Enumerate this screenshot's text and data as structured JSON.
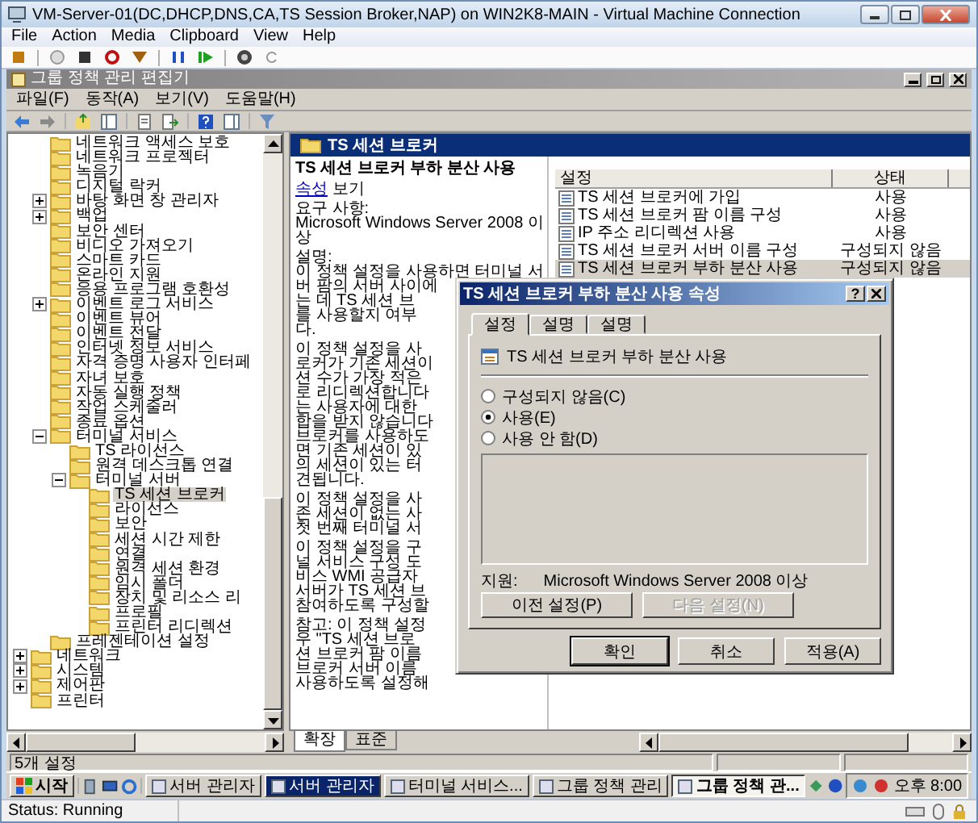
{
  "vm_window": {
    "title": "VM-Server-01(DC,DHCP,DNS,CA,TS Session Broker,NAP) on WIN2K8-MAIN - Virtual Machine Connection",
    "menu": [
      "File",
      "Action",
      "Media",
      "Clipboard",
      "View",
      "Help"
    ],
    "status": "Status: Running"
  },
  "mmc": {
    "title": "그룹 정책 관리 편집기",
    "menu": [
      "파일(F)",
      "동작(A)",
      "보기(V)",
      "도움말(H)"
    ]
  },
  "tree": {
    "items": [
      {
        "children": [
          {
            "label": "네트워크 액세스 보호",
            "selected": false
          },
          {
            "label": "네트워크 프로젝터",
            "selected": false
          },
          {
            "label": "녹음기",
            "selected": false
          },
          {
            "label": "디지털 락커",
            "selected": false
          },
          {
            "label": "바탕 화면 창 관리자",
            "selected": false,
            "expanded": false
          },
          {
            "label": "백업",
            "selected": false,
            "expanded": false
          },
          {
            "label": "보안 센터",
            "selected": false
          },
          {
            "label": "비디오 가져오기",
            "selected": false
          },
          {
            "label": "스마트 카드",
            "selected": false
          },
          {
            "label": "온라인 지원",
            "selected": false
          },
          {
            "label": "응용 프로그램 호환성",
            "selected": false
          },
          {
            "label": "이벤트 로그 서비스",
            "selected": false,
            "expanded": false
          },
          {
            "label": "이벤트 뷰어",
            "selected": false
          },
          {
            "label": "이벤트 전달",
            "selected": false
          },
          {
            "label": "인터넷 정보 서비스",
            "selected": false
          },
          {
            "label": "자격 증명 사용자 인터페",
            "selected": false
          },
          {
            "label": "자녀 보호",
            "selected": false
          },
          {
            "label": "자동 실행 정책",
            "selected": false
          },
          {
            "label": "작업 스케줄러",
            "selected": false
          },
          {
            "label": "종료 옵션",
            "selected": false
          },
          {
            "label": "터미널 서비스",
            "selected": false,
            "expanded": true,
            "children": [
              {
                "label": "TS 라이선스",
                "selected": false
              },
              {
                "label": "원격 데스크톱 연결",
                "selected": false
              },
              {
                "label": "터미널 서버",
                "selected": false,
                "expanded": true,
                "children": [
                  {
                    "label": "TS 세션 브로커",
                    "selected": true
                  },
                  {
                    "label": "라이선스",
                    "selected": false
                  },
                  {
                    "label": "보안",
                    "selected": false
                  },
                  {
                    "label": "세션 시간 제한",
                    "selected": false
                  },
                  {
                    "label": "연결",
                    "selected": false
                  },
                  {
                    "label": "원격 세션 환경",
                    "selected": false
                  },
                  {
                    "label": "임시 폴더",
                    "selected": false
                  },
                  {
                    "label": "장치 및 리소스 리",
                    "selected": false
                  },
                  {
                    "label": "프로필",
                    "selected": false
                  },
                  {
                    "label": "프린터 리디렉션",
                    "selected": false
                  }
                ]
              }
            ]
          },
          {
            "label": "프레젠테이션 설정",
            "selected": false
          }
        ]
      },
      {
        "label": "네트워크",
        "selected": false,
        "expanded": false
      },
      {
        "label": "시스템",
        "selected": false,
        "expanded": false
      },
      {
        "label": "제어판",
        "selected": false,
        "expanded": false
      },
      {
        "label": "프린터",
        "selected": false
      }
    ]
  },
  "pane_header": "TS 세션 브로커",
  "details": {
    "heading": "TS 세션 브로커 부하 분산 사용",
    "link": "속성",
    "link_rest": "보기",
    "paragraphs": [
      [
        "요구 사항:",
        "Microsoft Windows Server 2008 이",
        "상"
      ],
      [
        "설명:",
        "이 정책 설정을 사용하면 터미널 서",
        "버 팜의 서버 사이에",
        "는 데 TS 세션 브",
        "를 사용할지 여부",
        "다."
      ],
      [
        "이 정책 설정을 사",
        "로커가 기존 세션이",
        "션 수가 가장 적은",
        "로 리디렉션합니다",
        "는 사용자에 대한",
        "합을 받지 않습니다",
        "브로커를 사용하도",
        "면 기존 세션이 있",
        "의 세션이 있는 터",
        "견됩니다."
      ],
      [
        "이 정책 설정을 사",
        "존 세션이 없는 사",
        "첫 번째 터미널 서"
      ],
      [
        "이 정책 설정을 구",
        "널 서비스 구성 도",
        "비스 WMI 공급자",
        "서버가 TS 세션 브",
        "참여하도록 구성할"
      ],
      [
        "참고: 이 정책 설정",
        "우 \"TS 세션 브로",
        "션 브로커 팜 이름",
        "브로커 서버 이름",
        "사용하도록 설정해"
      ]
    ]
  },
  "list": {
    "columns": [
      "설정",
      "상태"
    ],
    "rows": [
      {
        "name": "TS 세션 브로커에 가입",
        "state": "사용",
        "selected": false
      },
      {
        "name": "TS 세션 브로커 팜 이름 구성",
        "state": "사용",
        "selected": false
      },
      {
        "name": "IP 주소 리디렉션 사용",
        "state": "사용",
        "selected": false
      },
      {
        "name": "TS 세션 브로커 서버 이름 구성",
        "state": "구성되지 않음",
        "selected": false
      },
      {
        "name": "TS 세션 브로커 부하 분산 사용",
        "state": "구성되지 않음",
        "selected": true
      }
    ]
  },
  "dialog": {
    "title": "TS 세션 브로커 부하 분산 사용 속성",
    "help": "?",
    "tabs": [
      {
        "label": "설정",
        "selected": true
      },
      {
        "label": "설명",
        "selected": false
      },
      {
        "label": "설명",
        "selected": false
      }
    ],
    "policy_name": "TS 세션 브로커 부하 분산 사용",
    "options": [
      {
        "label": "구성되지 않음(C)",
        "selected": false
      },
      {
        "label": "사용(E)",
        "selected": true
      },
      {
        "label": "사용 안 함(D)",
        "selected": false
      }
    ],
    "supported_label": "지원:",
    "supported_value": "Microsoft Windows Server 2008 이상",
    "nav_buttons": [
      {
        "label": "이전 설정(P)",
        "disabled": false
      },
      {
        "label": "다음 설정(N)",
        "disabled": true
      }
    ],
    "buttons": [
      {
        "label": "확인",
        "default": true
      },
      {
        "label": "취소",
        "default": false
      },
      {
        "label": "적용(A)",
        "default": false
      }
    ]
  },
  "view_tabs": [
    {
      "label": "확장",
      "selected": true
    },
    {
      "label": "표준",
      "selected": false
    }
  ],
  "status_bar": "5개 설정",
  "taskbar": {
    "start": "시작",
    "tasks": [
      {
        "label": "서버 관리자",
        "selected": false,
        "highlighted": false
      },
      {
        "label": "서버 관리자",
        "selected": false,
        "highlighted": true
      },
      {
        "label": "터미널 서비스...",
        "selected": false,
        "highlighted": false
      },
      {
        "label": "그룹 정책 관리",
        "selected": false,
        "highlighted": false
      },
      {
        "label": "그룹 정책 관...",
        "selected": true,
        "highlighted": false
      }
    ],
    "clock": "오후 8:00"
  }
}
